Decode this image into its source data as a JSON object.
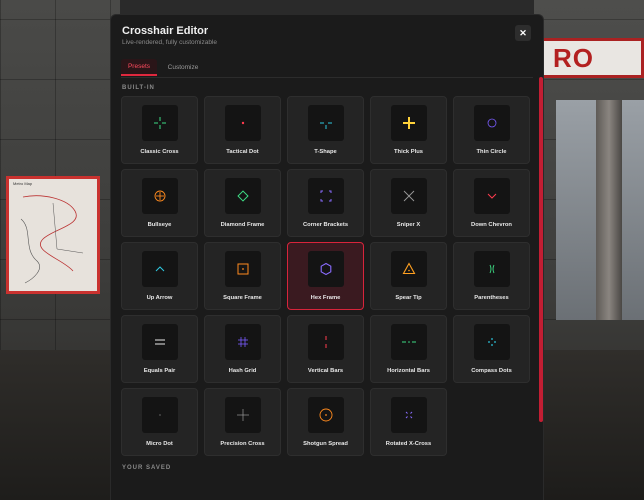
{
  "background": {
    "sign_text": "RO",
    "map_title": "Metro Map"
  },
  "modal": {
    "title": "Crosshair Editor",
    "subtitle": "Live-rendered, fully customizable",
    "close_label": "✕",
    "tabs": [
      {
        "label": "Presets",
        "active": true
      },
      {
        "label": "Customize",
        "active": false
      }
    ],
    "builtin_label": "BUILT-IN",
    "saved_label": "YOUR SAVED"
  },
  "presets": [
    {
      "label": "Classic Cross",
      "icon": "classic-cross-icon",
      "color": "#3ddc84"
    },
    {
      "label": "Tactical Dot",
      "icon": "dot-icon",
      "color": "#ff3b4e"
    },
    {
      "label": "T-Shape",
      "icon": "t-shape-icon",
      "color": "#2ec8e0"
    },
    {
      "label": "Thick Plus",
      "icon": "thick-plus-icon",
      "color": "#ffd23a"
    },
    {
      "label": "Thin Circle",
      "icon": "circle-icon",
      "color": "#7a5cff"
    },
    {
      "label": "Bullseye",
      "icon": "bullseye-icon",
      "color": "#ff8a1e"
    },
    {
      "label": "Diamond Frame",
      "icon": "diamond-icon",
      "color": "#3ddc84"
    },
    {
      "label": "Corner Brackets",
      "icon": "corner-brackets-icon",
      "color": "#8a6cff"
    },
    {
      "label": "Sniper X",
      "icon": "x-icon",
      "color": "#9a9a9a"
    },
    {
      "label": "Down Chevron",
      "icon": "chevron-down-icon",
      "color": "#ff3b4e"
    },
    {
      "label": "Up Arrow",
      "icon": "chevron-up-icon",
      "color": "#2ec8e0"
    },
    {
      "label": "Square Frame",
      "icon": "square-frame-icon",
      "color": "#ff8a1e"
    },
    {
      "label": "Hex Frame",
      "icon": "hexagon-icon",
      "color": "#8a6cff",
      "selected": true
    },
    {
      "label": "Spear Tip",
      "icon": "triangle-icon",
      "color": "#ffa020"
    },
    {
      "label": "Parentheses",
      "icon": "parentheses-icon",
      "color": "#3ddc84"
    },
    {
      "label": "Equals Pair",
      "icon": "equals-icon",
      "color": "#e8e8e8"
    },
    {
      "label": "Hash Grid",
      "icon": "hash-icon",
      "color": "#7a5cff"
    },
    {
      "label": "Vertical Bars",
      "icon": "vertical-bars-icon",
      "color": "#ff3b4e"
    },
    {
      "label": "Horizontal Bars",
      "icon": "horizontal-bars-icon",
      "color": "#3ddc84"
    },
    {
      "label": "Compass Dots",
      "icon": "compass-dots-icon",
      "color": "#2ec8e0"
    },
    {
      "label": "Micro Dot",
      "icon": "micro-dot-icon",
      "color": "#9a9a9a"
    },
    {
      "label": "Precision Cross",
      "icon": "precision-cross-icon",
      "color": "#9a9a9a"
    },
    {
      "label": "Shotgun Spread",
      "icon": "shotgun-spread-icon",
      "color": "#ff8a1e"
    },
    {
      "label": "Rotated X-Cross",
      "icon": "rotated-x-icon",
      "color": "#8a6cff"
    }
  ],
  "colors": {
    "accent": "#e0283e",
    "panel": "#1b1b1b",
    "card": "#242424"
  }
}
